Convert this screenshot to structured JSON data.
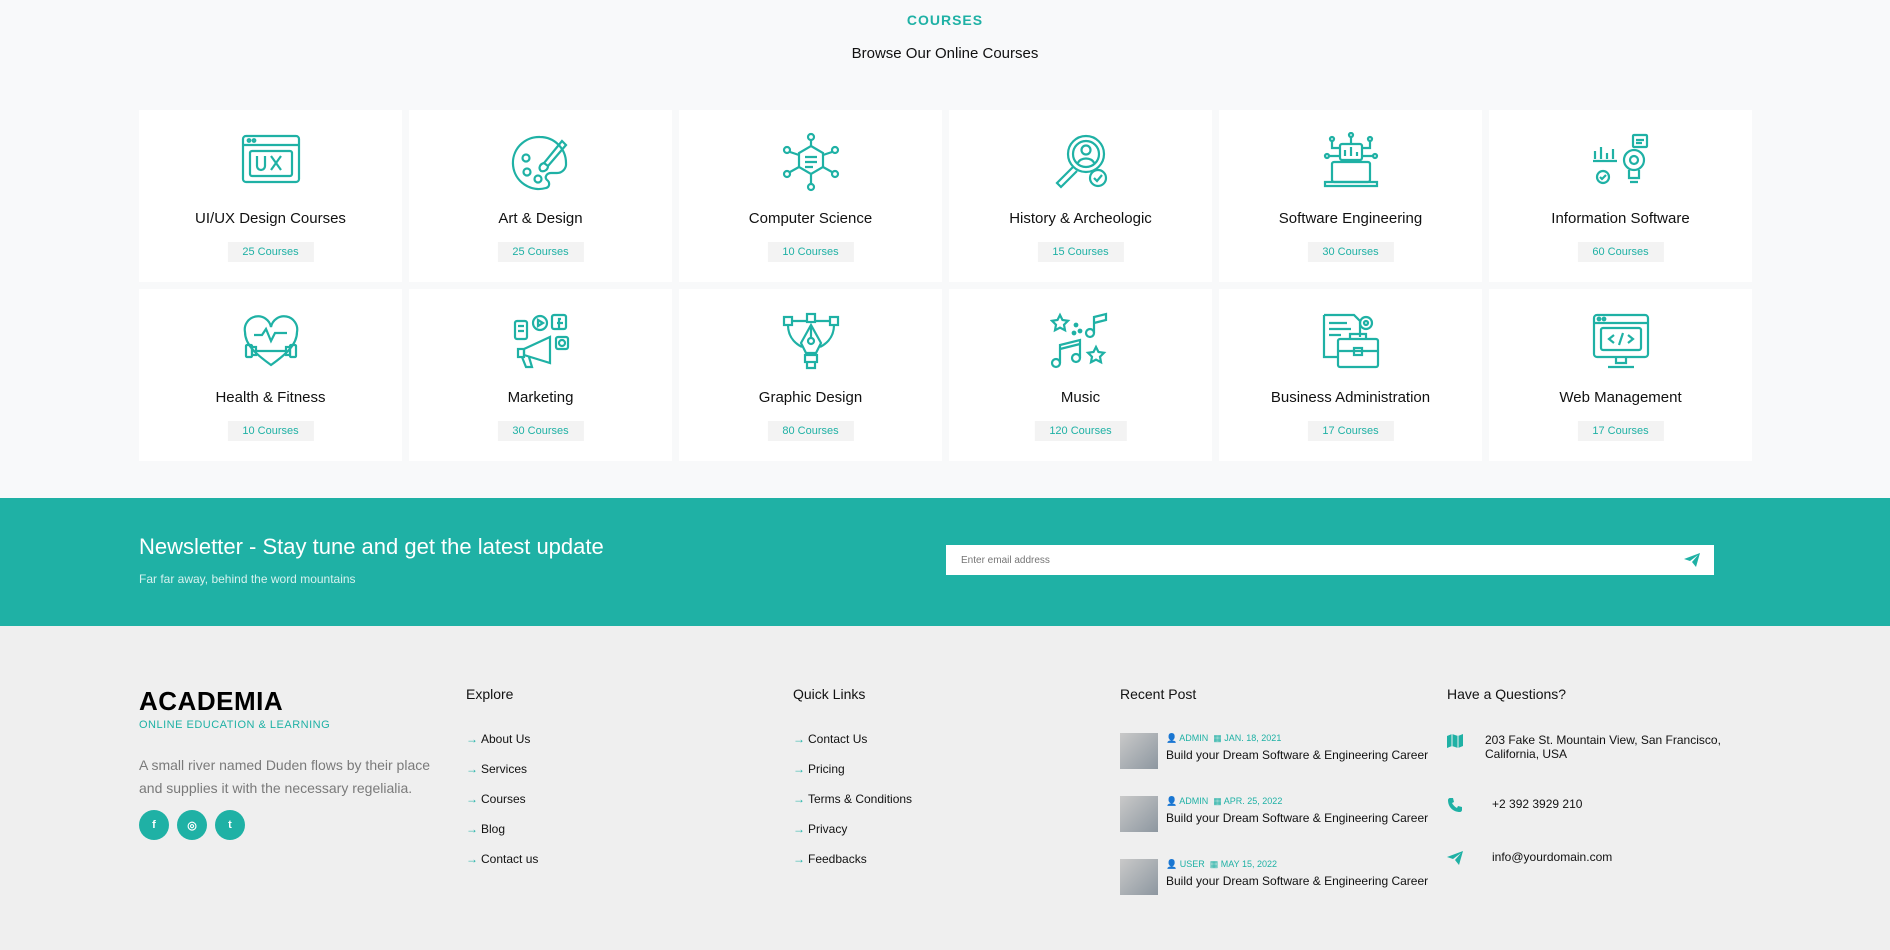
{
  "section": {
    "eyebrow": "COURSES",
    "heading": "Browse Our Online Courses"
  },
  "courses": [
    {
      "title": "UI/UX Design Courses",
      "count": "25 Courses",
      "icon": "ux-window-icon"
    },
    {
      "title": "Art & Design",
      "count": "25 Courses",
      "icon": "palette-icon"
    },
    {
      "title": "Computer Science",
      "count": "10 Courses",
      "icon": "hexagon-network-icon"
    },
    {
      "title": "History & Archeologic",
      "count": "15 Courses",
      "icon": "magnifier-person-icon"
    },
    {
      "title": "Software Engineering",
      "count": "30 Courses",
      "icon": "laptop-circuit-icon"
    },
    {
      "title": "Information Software",
      "count": "60 Courses",
      "icon": "lightbulb-chart-icon"
    },
    {
      "title": "Health & Fitness",
      "count": "10 Courses",
      "icon": "heart-dumbbell-icon"
    },
    {
      "title": "Marketing",
      "count": "30 Courses",
      "icon": "megaphone-icon"
    },
    {
      "title": "Graphic Design",
      "count": "80 Courses",
      "icon": "pen-tool-icon"
    },
    {
      "title": "Music",
      "count": "120 Courses",
      "icon": "music-notes-icon"
    },
    {
      "title": "Business Administration",
      "count": "17 Courses",
      "icon": "briefcase-icon"
    },
    {
      "title": "Web Management",
      "count": "17 Courses",
      "icon": "code-monitor-icon"
    }
  ],
  "newsletter": {
    "title": "Newsletter - Stay tune and get the latest update",
    "subtitle": "Far far away, behind the word mountains",
    "placeholder": "Enter email address",
    "send_icon": "paper-plane-icon"
  },
  "footer": {
    "brand": "ACADEMIA",
    "tagline": "ONLINE EDUCATION & LEARNING",
    "description": "A small river named Duden flows by their place and supplies it with the necessary regelialia.",
    "socials": [
      {
        "label": "f",
        "icon": "facebook-icon"
      },
      {
        "label": "◎",
        "icon": "instagram-icon"
      },
      {
        "label": "t",
        "icon": "twitter-icon"
      }
    ],
    "explore": {
      "title": "Explore",
      "items": [
        "About Us",
        "Services",
        "Courses",
        "Blog",
        "Contact us"
      ]
    },
    "quick_links": {
      "title": "Quick Links",
      "items": [
        "Contact Us",
        "Pricing",
        "Terms & Conditions",
        "Privacy",
        "Feedbacks"
      ]
    },
    "recent_post": {
      "title": "Recent Post",
      "posts": [
        {
          "author": "ADMIN",
          "date": "JAN. 18, 2021",
          "title": "Build your Dream Software & Engineering Career"
        },
        {
          "author": "ADMIN",
          "date": "APR. 25, 2022",
          "title": "Build your Dream Software & Engineering Career"
        },
        {
          "author": "USER",
          "date": "MAY 15, 2022",
          "title": "Build your Dream Software & Engineering Career"
        }
      ]
    },
    "contact": {
      "title": "Have a Questions?",
      "address": "203 Fake St. Mountain View, San Francisco, California, USA",
      "phone": "+2 392 3929 210",
      "email": "info@yourdomain.com"
    }
  },
  "colors": {
    "accent": "#1fb1a5",
    "footer_bg": "#efefef",
    "page_bg": "#f8f9fa"
  }
}
